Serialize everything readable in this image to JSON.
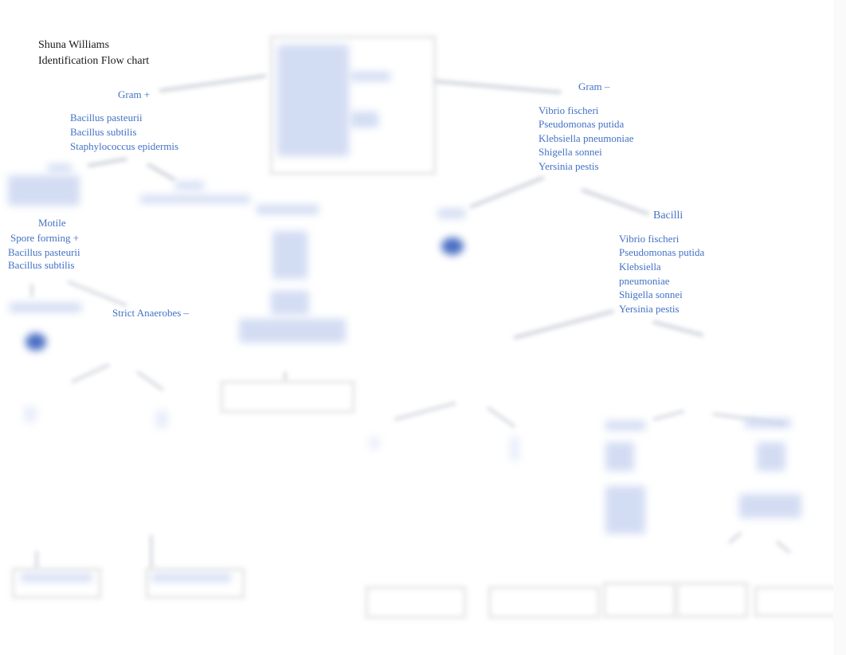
{
  "header": {
    "author": "Shuna Williams",
    "title": "Identification Flow chart"
  },
  "gram_positive": {
    "label": "Gram +",
    "organisms": [
      "Bacillus pasteurii",
      "Bacillus subtilis",
      "Staphylococcus epidermis"
    ]
  },
  "gram_negative": {
    "label": "Gram –",
    "organisms": [
      "Vibrio fischeri",
      "Pseudomonas putida",
      "Klebsiella pneumoniae",
      "Shigella sonnei",
      "Yersinia pestis"
    ]
  },
  "motile_branch": {
    "lines": [
      "Motile",
      "Spore forming +",
      "Bacillus pasteurii",
      "Bacillus subtilis"
    ]
  },
  "strict_anaerobes": {
    "label": "Strict Anaerobes –"
  },
  "bacilli": {
    "label": "Bacilli",
    "organisms": [
      "Vibrio fischeri",
      "Pseudomonas putida",
      "Klebsiella",
      "pneumoniae",
      "Shigella sonnei",
      "Yersinia pestis"
    ]
  },
  "colors": {
    "text_blue": "#4472c4",
    "text_black": "#1a1a1a"
  }
}
